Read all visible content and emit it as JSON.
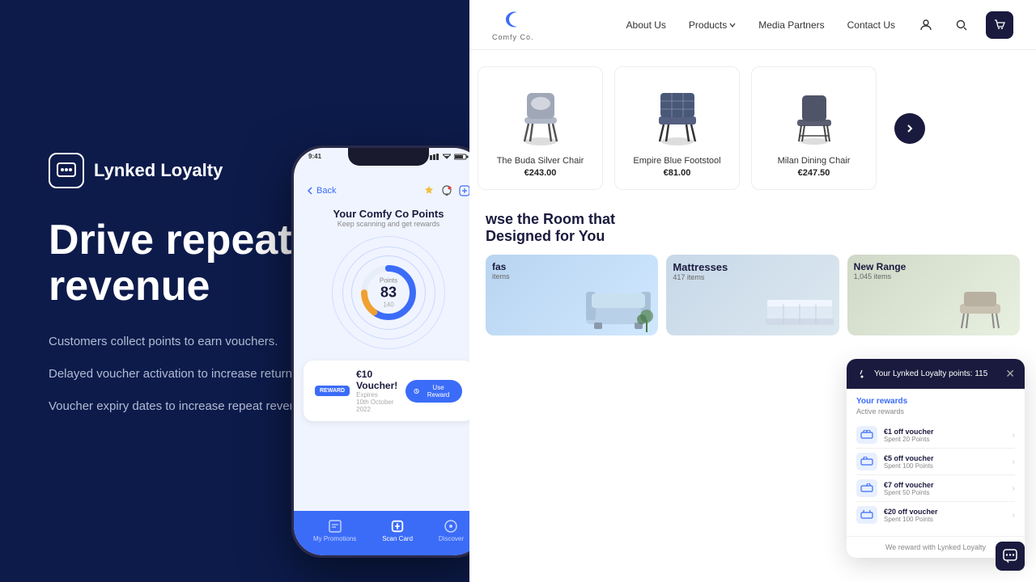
{
  "leftPanel": {
    "logoText": "Lynked Loyalty",
    "headline": "Drive repeat revenue",
    "points": [
      "Customers collect points to earn vouchers.",
      "Delayed voucher activation to increase return customer visits.",
      "Voucher expiry dates to increase repeat revenue."
    ]
  },
  "phone": {
    "time": "9:41",
    "backLabel": "Back",
    "title": "Your Comfy Co Points",
    "subtitle": "Keep scanning and get rewards",
    "pointsValue": "83",
    "pointsTotal": "140",
    "pointsLabel": "Points",
    "voucherAmount": "€10 Voucher!",
    "voucherExpires": "Expires",
    "voucherDate": "10th October 2022",
    "useRewardLabel": "Use Reward",
    "nav": {
      "myPromotions": "My Promotions",
      "scanCard": "Scan Card",
      "discover": "Discover"
    }
  },
  "website": {
    "brandName": "Comfy Co.",
    "nav": {
      "aboutUs": "About Us",
      "products": "Products",
      "mediaPartners": "Media Partners",
      "contactUs": "Contact Us"
    },
    "products": [
      {
        "name": "The Buda Silver Chair",
        "price": "€243.00"
      },
      {
        "name": "Empire Blue Footstool",
        "price": "€81.00"
      },
      {
        "name": "Milan Dining Chair",
        "price": "€247.50"
      }
    ],
    "browseTitle": "wse the Room that\nDesigned for You",
    "categories": [
      {
        "name": "fas",
        "count": "items"
      },
      {
        "name": "Mattresses",
        "count": "417 items"
      },
      {
        "name": "New Range",
        "count": "1,045 items"
      }
    ]
  },
  "loyaltyWidget": {
    "headerText": "Your Lynked Loyalty points: 115",
    "yourRewards": "Your rewards",
    "activeRewards": "Active rewards",
    "rewards": [
      {
        "name": "€1 off voucher",
        "points": "Spent 20 Points"
      },
      {
        "name": "€5 off voucher",
        "points": "Spent 100 Points"
      },
      {
        "name": "€7 off voucher",
        "points": "Spent 50 Points"
      },
      {
        "name": "€20 off voucher",
        "points": "Spent 100 Points"
      }
    ],
    "footer": "We reward with Lynked Loyalty"
  }
}
